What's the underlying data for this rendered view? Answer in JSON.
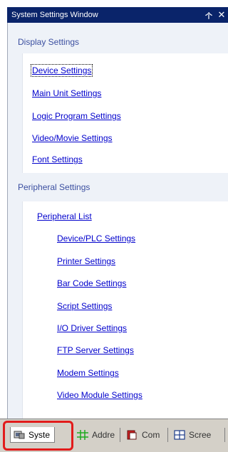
{
  "window": {
    "title": "System Settings Window",
    "pin_glyph": "ͨ",
    "close_glyph": "✕"
  },
  "display_settings": {
    "header": "Display Settings",
    "items": [
      {
        "label": "Device Settings",
        "focused": true
      },
      {
        "label": "Main Unit Settings"
      },
      {
        "label": "Logic Program Settings"
      },
      {
        "label": "Video/Movie Settings"
      },
      {
        "label": "Font Settings"
      }
    ]
  },
  "peripheral_settings": {
    "header": "Peripheral Settings",
    "items": [
      {
        "label": "Peripheral List"
      },
      {
        "label": "Device/PLC Settings"
      },
      {
        "label": "Printer Settings"
      },
      {
        "label": "Bar Code Settings"
      },
      {
        "label": "Script Settings"
      },
      {
        "label": "I/O Driver Settings"
      },
      {
        "label": "FTP Server Settings"
      },
      {
        "label": "Modem Settings"
      },
      {
        "label": "Video Module Settings"
      }
    ]
  },
  "tabs": [
    {
      "label": "Syste",
      "icon": "system-settings-icon",
      "active": true
    },
    {
      "label": "Addre",
      "icon": "address-grid-icon"
    },
    {
      "label": "Com",
      "icon": "common-settings-icon"
    },
    {
      "label": "Scree",
      "icon": "screen-list-icon"
    }
  ],
  "colors": {
    "title_bar": "#0a246a",
    "panel_bg": "#eef2f8",
    "section_header": "#3b4fa0",
    "link": "#0000cc",
    "highlight": "#e21b1b"
  }
}
